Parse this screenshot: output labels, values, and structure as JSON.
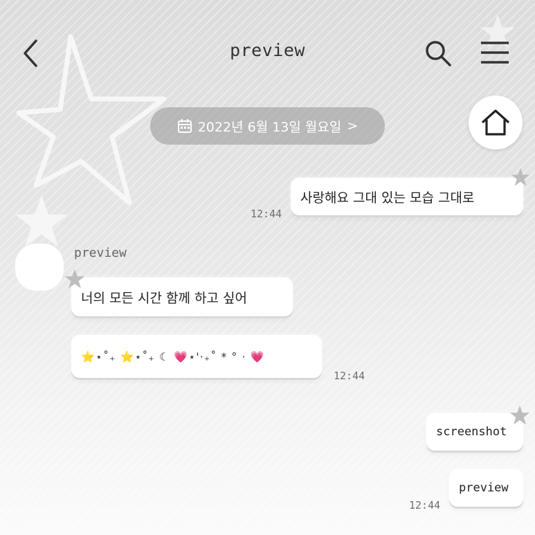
{
  "header": {
    "title": "preview",
    "back_icon": "chevron-left-icon",
    "search_icon": "search-icon",
    "menu_icon": "hamburger-menu-icon"
  },
  "date_divider": {
    "text": "2022년 6월 13일 월요일",
    "icon": "calendar-icon",
    "chevron": ">"
  },
  "home_button": {
    "icon": "home-icon"
  },
  "messages": [
    {
      "side": "right",
      "text": "사랑해요 그대 있는 모습 그대로",
      "time": "12:44"
    },
    {
      "side": "left",
      "sender": "preview",
      "text": "너의 모든 시간 함께 하고 싶어"
    },
    {
      "side": "left",
      "glyphs": "⭐⋆˚₊ ⭐⋆˚₊ ☾ 💗⋆'·₊˚ * ° · 💗",
      "time": "12:44"
    },
    {
      "side": "right",
      "text": "screenshot"
    },
    {
      "side": "right",
      "text": "preview",
      "time": "12:44"
    }
  ],
  "colors": {
    "bubble": "#ffffff",
    "star_yellow": "#f5e94a",
    "heart_pink": "#f3a6d6",
    "date_pill": "#9a9a9a"
  }
}
